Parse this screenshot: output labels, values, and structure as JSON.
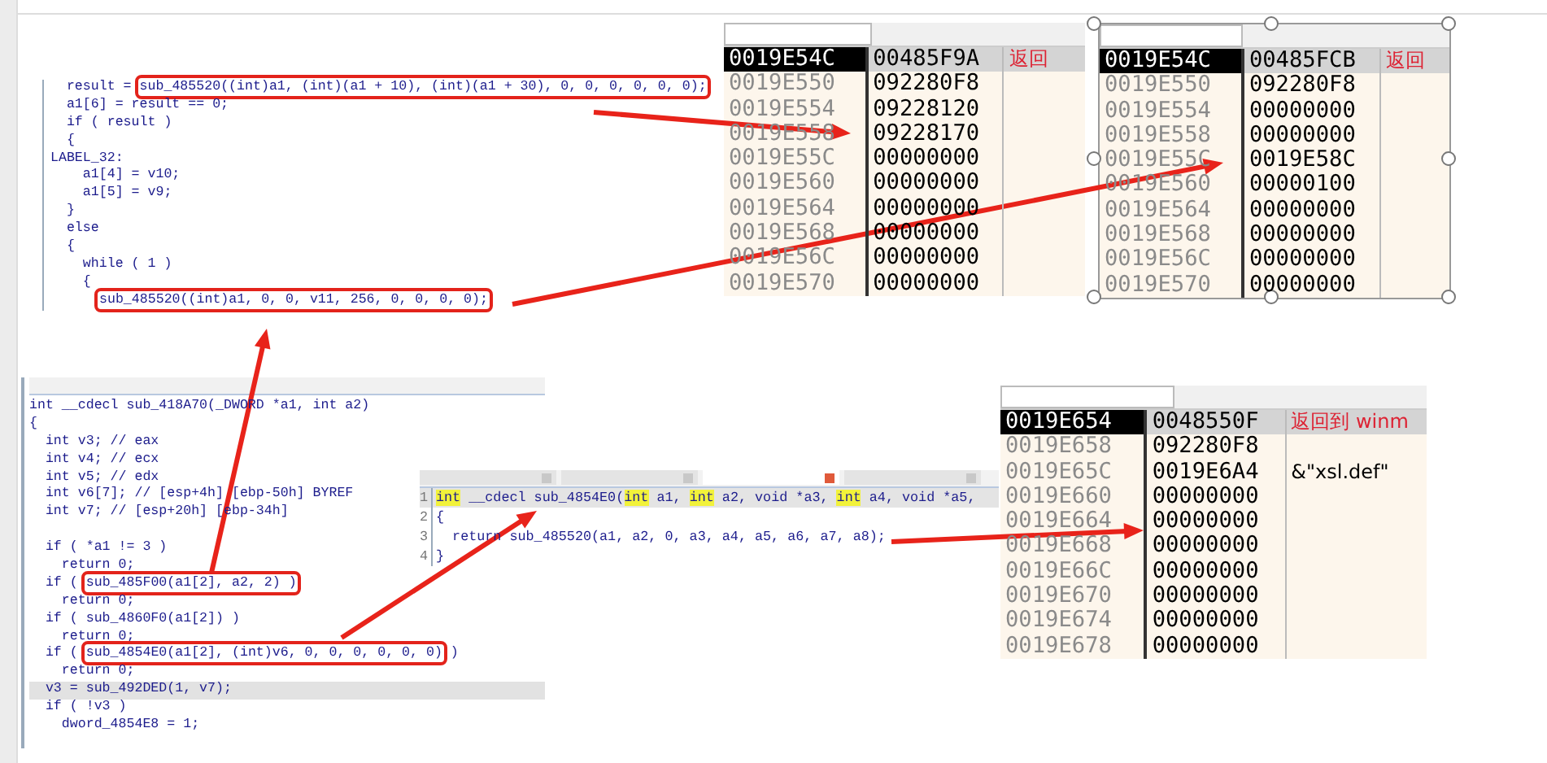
{
  "code_top": {
    "lines": [
      {
        "text": "  result = ",
        "boxed": "sub_485520((int)a1, (int)(a1 + 10), (int)(a1 + 30), 0, 0, 0, 0, 0, 0);"
      },
      {
        "text": "  a1[6] = result == 0;"
      },
      {
        "text": "  if ( result )"
      },
      {
        "text": "  {"
      },
      {
        "text": "LABEL_32:"
      },
      {
        "text": "    a1[4] = v10;"
      },
      {
        "text": "    a1[5] = v9;"
      },
      {
        "text": "  }"
      },
      {
        "text": "  else"
      },
      {
        "text": "  {"
      },
      {
        "text": "    while ( 1 )"
      },
      {
        "text": "    {"
      },
      {
        "boxed": "sub_485520((int)a1, 0, 0, v11, 256, 0, 0, 0, 0);",
        "indent": true
      }
    ]
  },
  "memory_views": [
    {
      "rows": [
        {
          "address": "0019E54C",
          "value": "00485F9A",
          "comment": "返回",
          "selected": true
        },
        {
          "address": "0019E550",
          "value": "092280F8",
          "selected": false
        },
        {
          "address": "0019E554",
          "value": "09228120",
          "selected": false
        },
        {
          "address": "0019E558",
          "value": "09228170",
          "selected": false
        },
        {
          "address": "0019E55C",
          "value": "00000000",
          "selected": false
        },
        {
          "address": "0019E560",
          "value": "00000000",
          "selected": false
        },
        {
          "address": "0019E564",
          "value": "00000000",
          "selected": false
        },
        {
          "address": "0019E568",
          "value": "00000000",
          "selected": false
        },
        {
          "address": "0019E56C",
          "value": "00000000",
          "selected": false
        },
        {
          "address": "0019E570",
          "value": "00000000",
          "selected": false
        }
      ]
    },
    {
      "rows": [
        {
          "address": "0019E54C",
          "value": "00485FCB",
          "comment": "返回",
          "selected": true
        },
        {
          "address": "0019E550",
          "value": "092280F8",
          "selected": false
        },
        {
          "address": "0019E554",
          "value": "00000000",
          "selected": false
        },
        {
          "address": "0019E558",
          "value": "00000000",
          "selected": false
        },
        {
          "address": "0019E55C",
          "value": "0019E58C",
          "selected": false
        },
        {
          "address": "0019E560",
          "value": "00000100",
          "selected": false
        },
        {
          "address": "0019E564",
          "value": "00000000",
          "selected": false
        },
        {
          "address": "0019E568",
          "value": "00000000",
          "selected": false
        },
        {
          "address": "0019E56C",
          "value": "00000000",
          "selected": false
        },
        {
          "address": "0019E570",
          "value": "00000000",
          "selected": false
        }
      ]
    },
    {
      "rows": [
        {
          "address": "0019E654",
          "value": "0048550F",
          "comment": "返回到 winm",
          "selected": true
        },
        {
          "address": "0019E658",
          "value": "092280F8",
          "selected": false
        },
        {
          "address": "0019E65C",
          "value": "0019E6A4",
          "comment": "&\"xsl.def\"",
          "selected": false
        },
        {
          "address": "0019E660",
          "value": "00000000",
          "selected": false
        },
        {
          "address": "0019E664",
          "value": "00000000",
          "selected": false
        },
        {
          "address": "0019E668",
          "value": "00000000",
          "selected": false
        },
        {
          "address": "0019E66C",
          "value": "00000000",
          "selected": false
        },
        {
          "address": "0019E670",
          "value": "00000000",
          "selected": false
        },
        {
          "address": "0019E674",
          "value": "00000000",
          "selected": false
        },
        {
          "address": "0019E678",
          "value": "00000000",
          "selected": false
        }
      ]
    }
  ],
  "code_bottom": {
    "lines": [
      {
        "text": "int __cdecl sub_418A70(_DWORD *a1, int a2)",
        "current": false
      },
      {
        "text": "{",
        "current": false
      },
      {
        "text": "  int v3; // eax",
        "current": false
      },
      {
        "text": "  int v4; // ecx",
        "current": false
      },
      {
        "text": "  int v5; // edx",
        "current": false
      },
      {
        "text": "  int v6[7]; // [esp+4h] [ebp-50h] BYREF",
        "current": false
      },
      {
        "text": "  int v7; // [esp+20h] [ebp-34h]",
        "current": false
      },
      {
        "text": "  if ( *a1 != 3 )",
        "current": false,
        "space_before": true
      },
      {
        "text": "    return 0;",
        "current": false
      },
      {
        "text": "  if ( ",
        "boxed": "sub_485F00(a1[2], a2, 2) )",
        "current": false
      },
      {
        "text": "    return 0;",
        "current": false
      },
      {
        "text": "  if ( sub_4860F0(a1[2]) )",
        "current": false
      },
      {
        "text": "    return 0;",
        "current": false
      },
      {
        "text": "  if ( ",
        "boxed": "sub_4854E0(a1[2], (int)v6, 0, 0, 0, 0, 0, 0)",
        "after": " )",
        "current": false
      },
      {
        "text": "    return 0;",
        "current": false
      },
      {
        "text": "  v3 = sub_492DED(1, v7);",
        "current": true
      },
      {
        "text": "  if ( !v3 )",
        "current": false
      },
      {
        "text": "    dword_4854E8 = 1;",
        "current": false
      }
    ]
  },
  "pseudocode_popup": {
    "tabs": [
      {
        "selected": false
      },
      {
        "selected": false
      },
      {
        "selected": true
      },
      {
        "selected": false
      }
    ],
    "lines": [
      {
        "number": "1",
        "segments": [
          {
            "text": "int",
            "hl": true
          },
          {
            "text": " __cdecl sub_4854E0(",
            "hl": false
          },
          {
            "text": "int",
            "hl": true
          },
          {
            "text": " a1, ",
            "hl": false
          },
          {
            "text": "int",
            "hl": true
          },
          {
            "text": " a2, void *a3, ",
            "hl": false
          },
          {
            "text": "int",
            "hl": true
          },
          {
            "text": " a4, void *a5,",
            "hl": false
          }
        ],
        "current": true
      },
      {
        "number": "2",
        "segments": [
          {
            "text": "{",
            "hl": false
          }
        ],
        "current": false
      },
      {
        "number": "3",
        "segments": [
          {
            "text": "  return sub_485520(a1, a2, 0, a3, a4, a5, a6, a7, a8);",
            "hl": false
          }
        ],
        "current": false
      },
      {
        "number": "4",
        "segments": [
          {
            "text": "}",
            "hl": false
          }
        ],
        "current": false
      }
    ]
  }
}
